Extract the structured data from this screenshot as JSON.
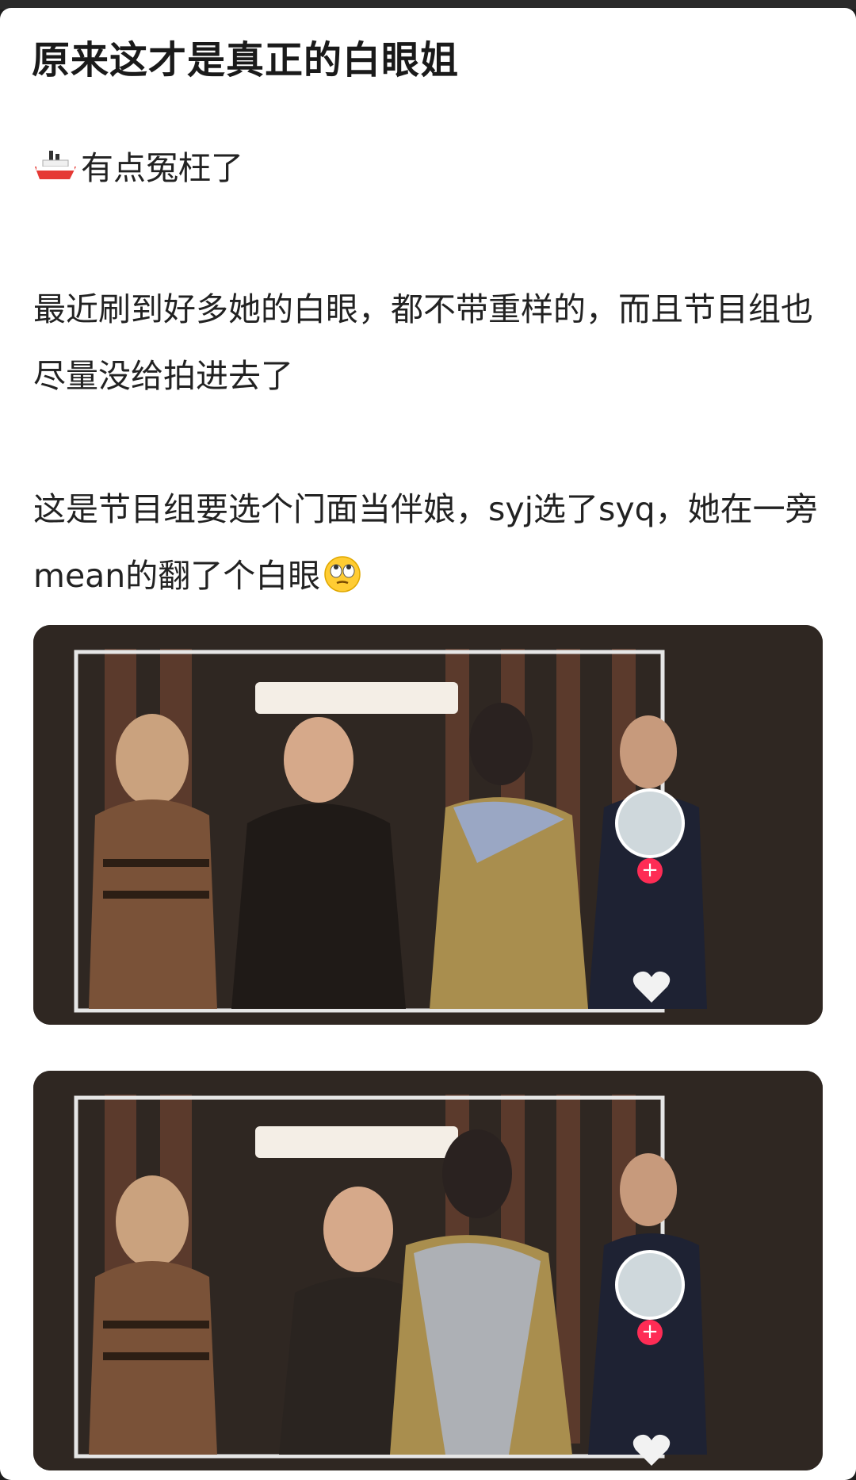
{
  "post": {
    "title": "原来这才是真正的白眼姐",
    "line1": "有点冤枉了",
    "line2": "最近刷到好多她的白眼，都不带重样的，而且节目组也尽量没给拍进去了",
    "line3": "这是节目组要选个门面当伴娘，syj选了syq，她在一旁mean的翻了个白眼"
  },
  "icons": {
    "ship": "ship-emoji",
    "eyeroll": "face-with-rolling-eyes-emoji",
    "follow": "plus-icon",
    "like": "heart-icon"
  },
  "colors": {
    "accent": "#fe2c55",
    "text": "#222222"
  }
}
